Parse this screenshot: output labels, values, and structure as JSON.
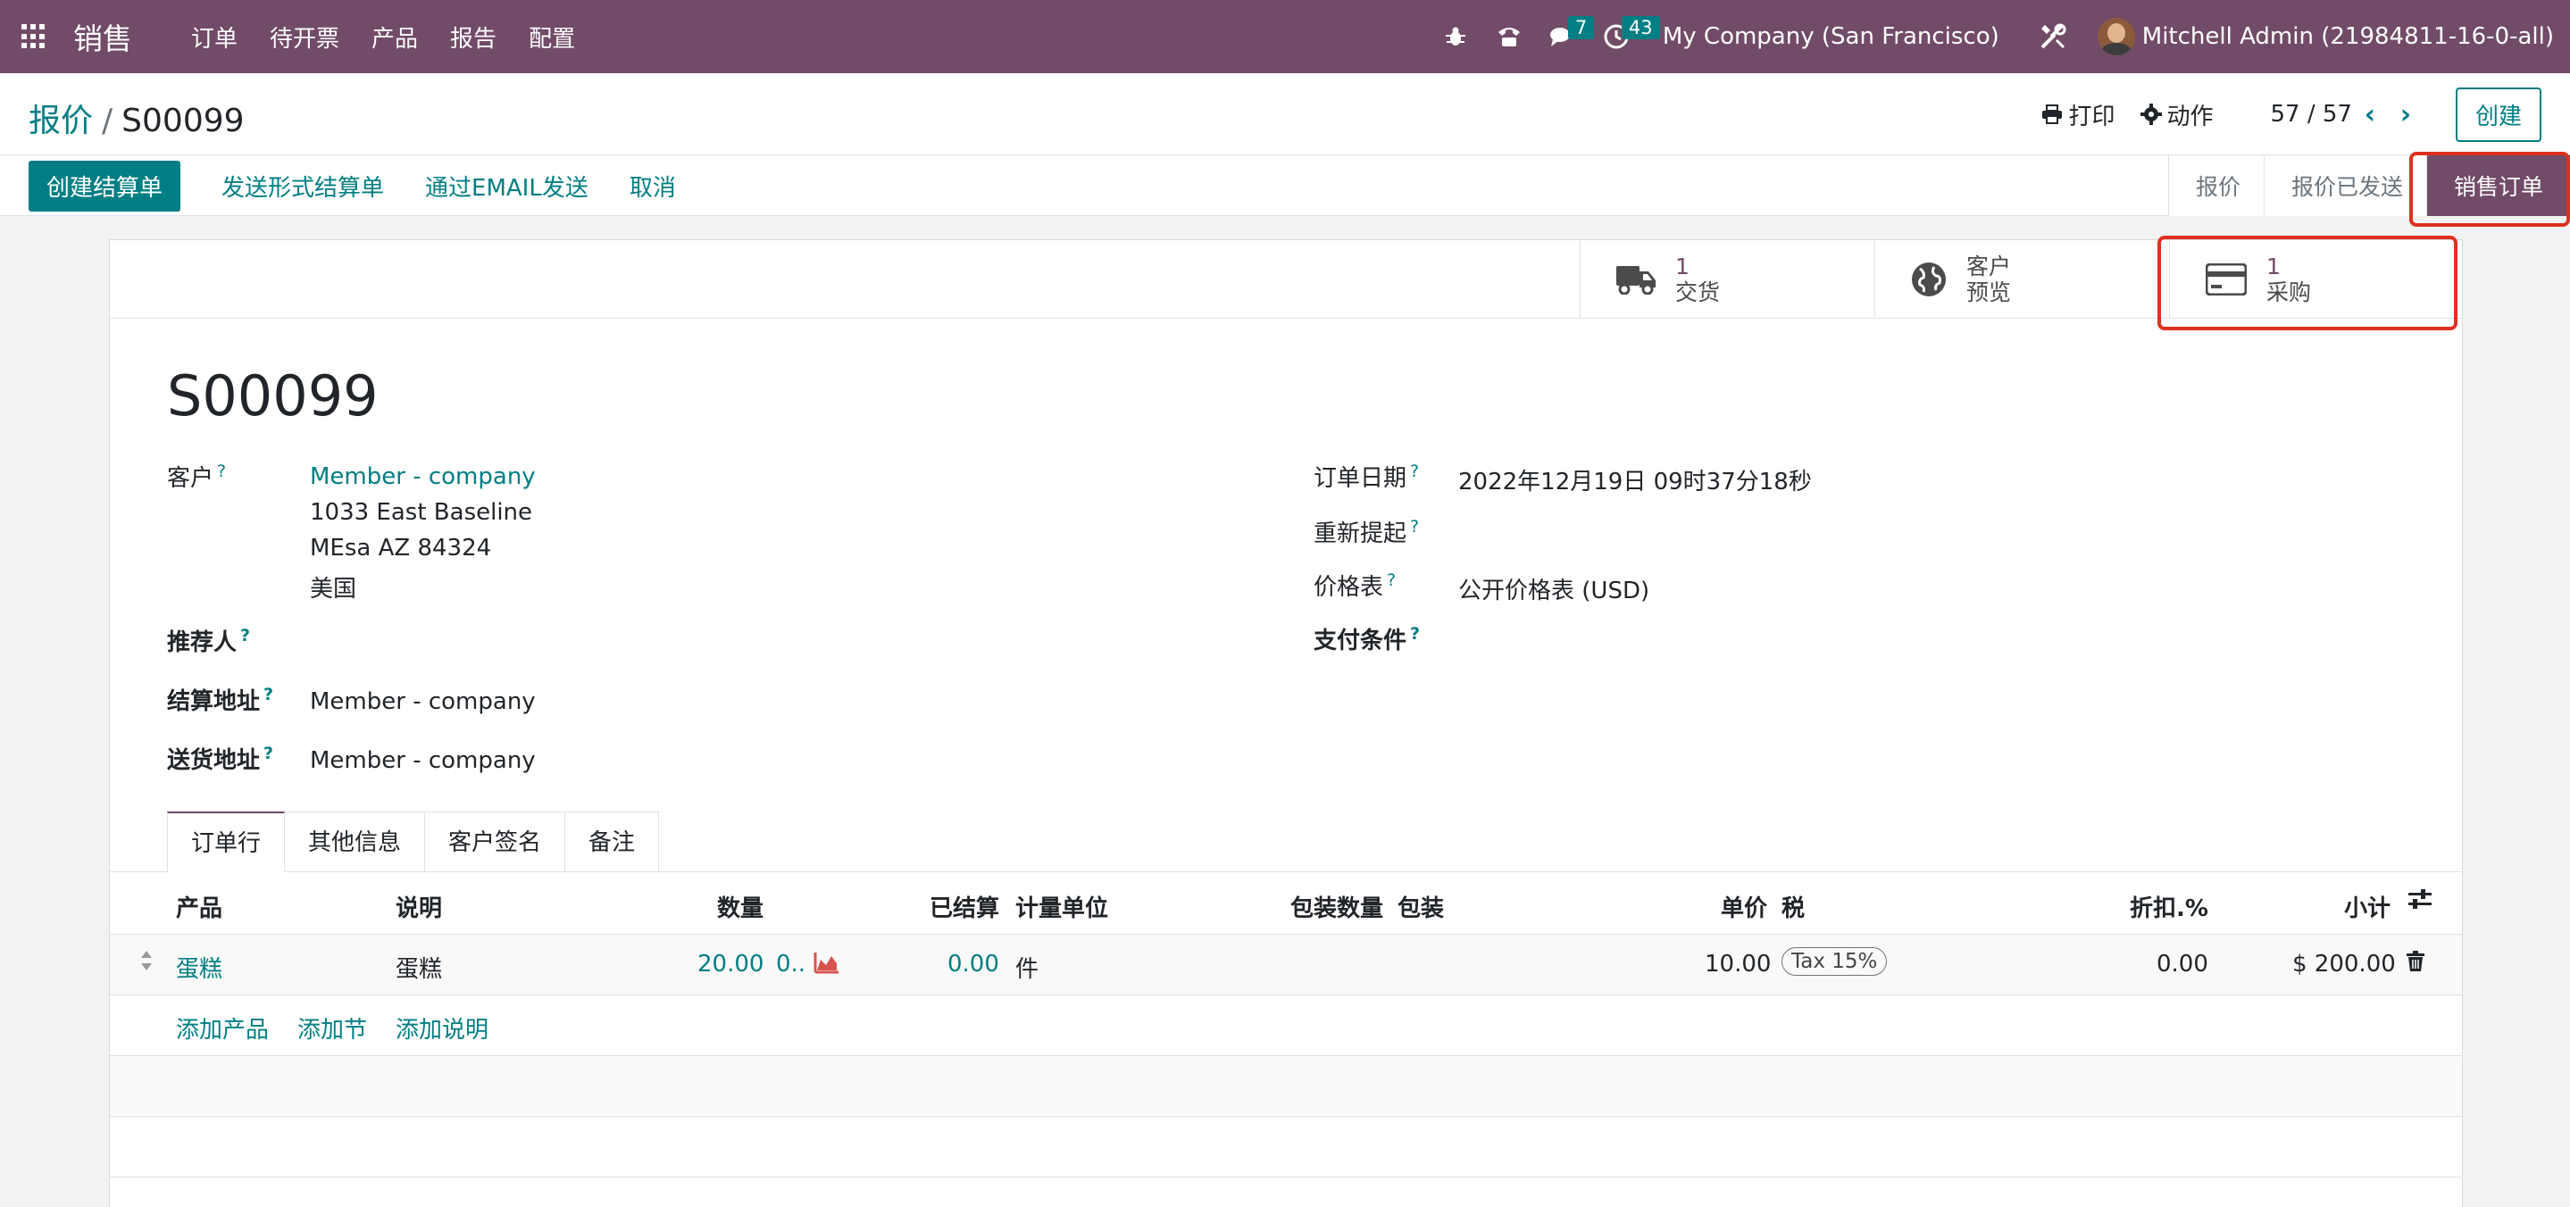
{
  "nav": {
    "app_name": "销售",
    "menu": [
      "订单",
      "待开票",
      "产品",
      "报告",
      "配置"
    ],
    "messages_count": "7",
    "activities_count": "43",
    "company": "My Company (San Francisco)",
    "user": "Mitchell Admin (21984811-16-0-all)"
  },
  "control_panel": {
    "breadcrumb_parent": "报价",
    "breadcrumb_sep": "/",
    "breadcrumb_current": "S00099",
    "print_label": "打印",
    "action_label": "动作",
    "pager": "57 / 57",
    "create_label": "创建"
  },
  "status_bar": {
    "buttons": [
      "创建结算单",
      "发送形式结算单",
      "通过EMAIL发送",
      "取消"
    ],
    "stages": [
      "报价",
      "报价已发送",
      "销售订单"
    ],
    "active_stage": "销售订单"
  },
  "smart_buttons": {
    "delivery": {
      "value": "1",
      "label": "交货"
    },
    "preview": {
      "line1": "客户",
      "line2": "预览"
    },
    "purchase": {
      "value": "1",
      "label": "采购"
    }
  },
  "record": {
    "name": "S00099",
    "customer_label": "客户",
    "customer_name": "Member - company",
    "address_line1": "1033 East Baseline",
    "address_line2": "MEsa AZ 84324",
    "address_line3": "美国",
    "referrer_label": "推荐人",
    "invoice_address_label": "结算地址",
    "invoice_address": "Member - company",
    "delivery_address_label": "送货地址",
    "delivery_address": "Member - company",
    "order_date_label": "订单日期",
    "order_date": "2022年12月19日 09时37分18秒",
    "reminder_label": "重新提起",
    "pricelist_label": "价格表",
    "pricelist": "公开价格表 (USD)",
    "payment_terms_label": "支付条件",
    "help_mark": "?"
  },
  "tabs": [
    "订单行",
    "其他信息",
    "客户签名",
    "备注"
  ],
  "order_lines": {
    "headers": {
      "product": "产品",
      "description": "说明",
      "quantity": "数量",
      "invoiced": "已结算",
      "uom": "计量单位",
      "pkg_qty": "包装数量",
      "packaging": "包装",
      "unit_price": "单价",
      "tax": "税",
      "discount": "折扣.%",
      "subtotal": "小计"
    },
    "rows": [
      {
        "product": "蛋糕",
        "description": "蛋糕",
        "quantity": "20.00",
        "delivered": "0..",
        "invoiced": "0.00",
        "uom": "件",
        "unit_price": "10.00",
        "tax": "Tax 15%",
        "discount": "0.00",
        "subtotal": "$ 200.00"
      }
    ],
    "add_product": "添加产品",
    "add_section": "添加节",
    "add_note": "添加说明"
  },
  "colors": {
    "brand": "#714b67",
    "accent": "#017e84",
    "highlight": "#e0301e"
  }
}
